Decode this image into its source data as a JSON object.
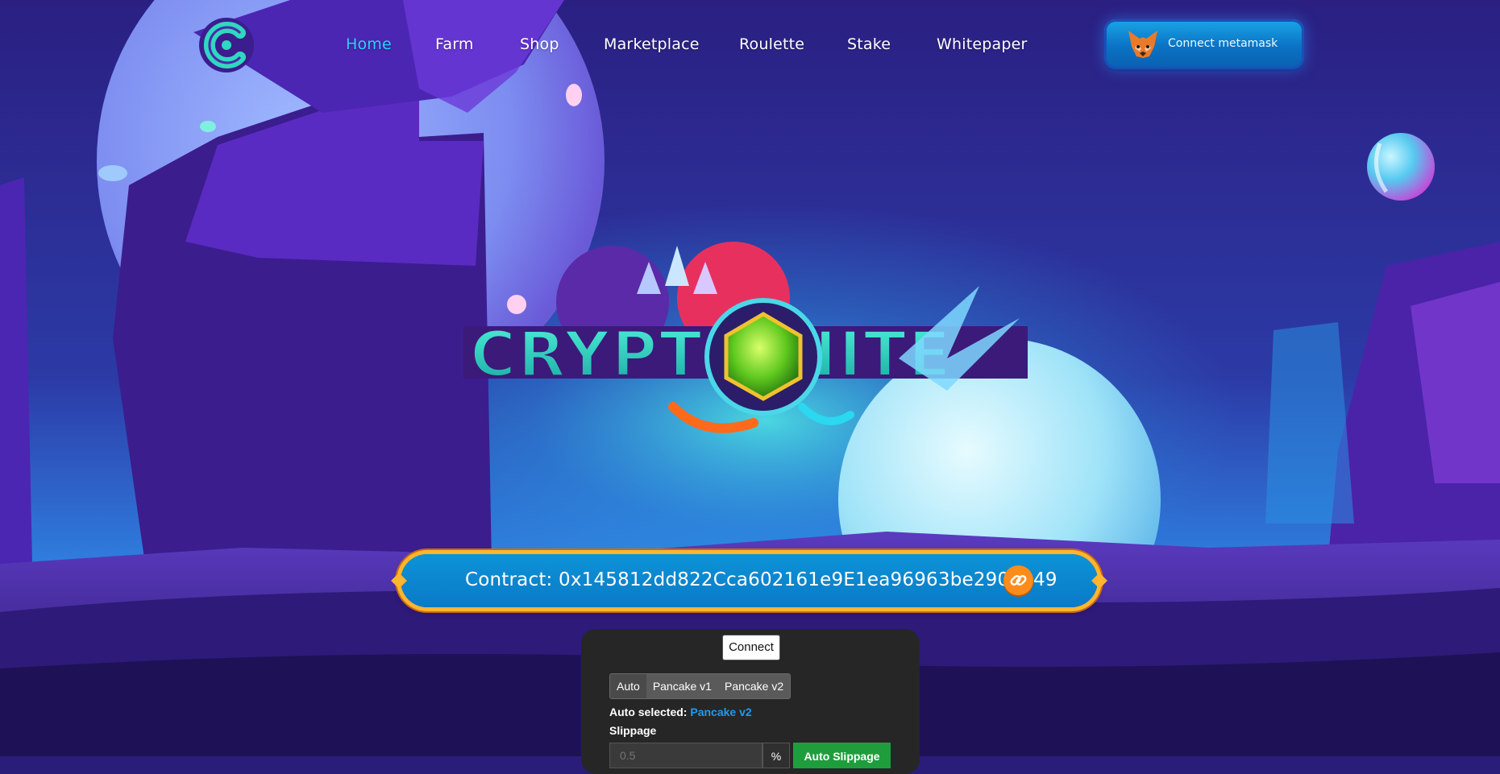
{
  "nav": {
    "items": [
      {
        "label": "Home",
        "active": true
      },
      {
        "label": "Farm",
        "active": false
      },
      {
        "label": "Shop",
        "active": false
      },
      {
        "label": "Marketplace",
        "active": false
      },
      {
        "label": "Roulette",
        "active": false
      },
      {
        "label": "Stake",
        "active": false
      },
      {
        "label": "Whitepaper",
        "active": false
      }
    ],
    "connect_label": "Connect metamask"
  },
  "contract": {
    "text": "Contract: 0x145812dd822Cca602161e9E1ea96963be290b549"
  },
  "swap": {
    "connect_label": "Connect",
    "routes": [
      "Auto",
      "Pancake v1",
      "Pancake v2"
    ],
    "auto_selected_label": "Auto selected:",
    "auto_selected_value": "Pancake v2",
    "slippage_label": "Slippage",
    "slippage_placeholder": "0.5",
    "percent_symbol": "%",
    "auto_slippage_label": "Auto Slippage"
  },
  "colors": {
    "active_nav": "#27d3ff",
    "contract_bg": "#0a7ac8",
    "contract_border": "#ffb52e",
    "link_button": "#ff8c1a",
    "auto_slippage": "#1f9d3d",
    "route_link": "#1d9bf0"
  },
  "icons": {
    "logo": "crypto-c-logo",
    "fox": "metamask-fox-icon",
    "link": "link-icon"
  }
}
